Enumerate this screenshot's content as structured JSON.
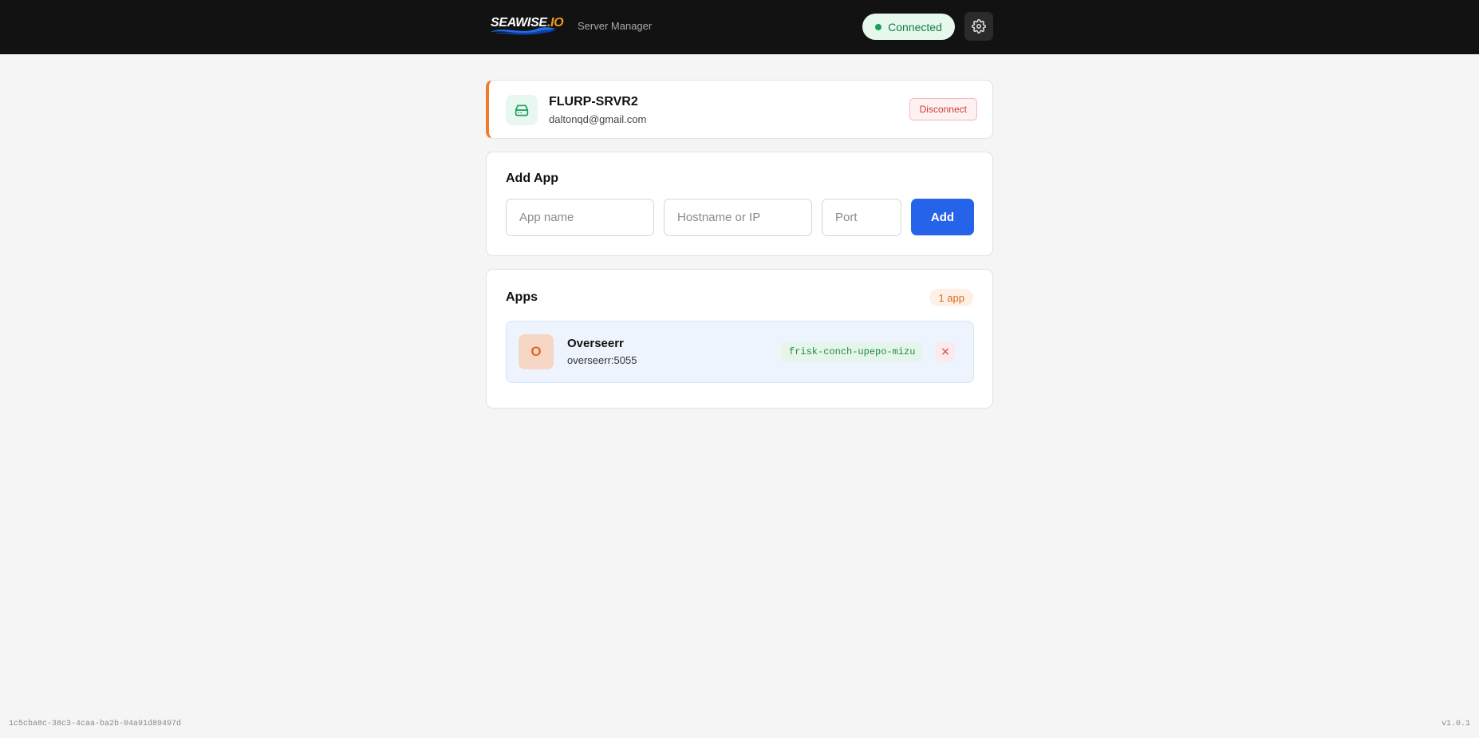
{
  "header": {
    "logo_main": "SEAWISE",
    "logo_suffix": ".IO",
    "subtitle": "Server Manager",
    "status_label": "Connected",
    "settings_icon": "gear-icon"
  },
  "server": {
    "icon": "server-icon",
    "name": "FLURP-SRVR2",
    "email": "daltonqd@gmail.com",
    "disconnect_label": "Disconnect"
  },
  "add_app": {
    "title": "Add App",
    "name_placeholder": "App name",
    "host_placeholder": "Hostname or IP",
    "port_placeholder": "Port",
    "add_label": "Add"
  },
  "apps": {
    "title": "Apps",
    "count_label": "1 app",
    "items": [
      {
        "initial": "O",
        "name": "Overseerr",
        "host": "overseerr:5055",
        "token": "frisk-conch-upepo-mizu",
        "remove_label": "×"
      }
    ]
  },
  "footer": {
    "id": "1c5cba8c-38c3-4caa-ba2b-04a91d89497d",
    "version": "v1.0.1"
  },
  "colors": {
    "header_bg": "#121212",
    "accent_orange": "#f07b2a",
    "primary_blue": "#2563eb",
    "status_green": "#1a9e58",
    "danger_red": "#d23b3b"
  }
}
